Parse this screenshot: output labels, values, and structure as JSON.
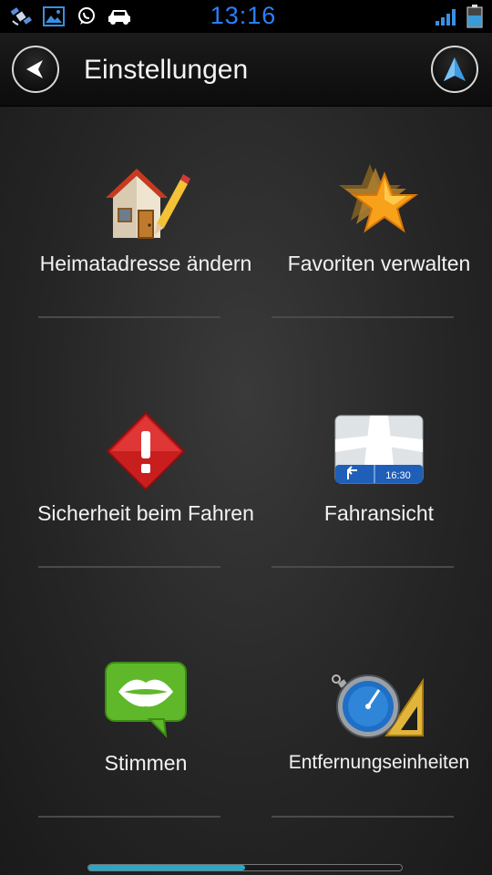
{
  "status_bar": {
    "time": "13:16",
    "icons": [
      "satellite-icon",
      "gallery-icon",
      "whatsapp-icon",
      "car-icon"
    ],
    "signal_icon": "signal-bars-icon",
    "battery_icon": "battery-icon"
  },
  "header": {
    "back_icon": "back-arrow-icon",
    "title": "Einstellungen",
    "nav_icon": "navigation-arrow-icon"
  },
  "menu": {
    "items": [
      {
        "label": "Heimatadresse ändern",
        "icon": "home-pencil-icon"
      },
      {
        "label": "Favoriten verwalten",
        "icon": "favorites-stars-icon"
      },
      {
        "label": "Sicherheit beim Fahren",
        "icon": "warning-diamond-icon"
      },
      {
        "label": "Fahransicht",
        "icon": "map-view-icon",
        "icon_text": "16:30"
      },
      {
        "label": "Stimmen",
        "icon": "voice-lips-icon"
      },
      {
        "label": "Entfernungseinheiten",
        "icon": "stopwatch-ruler-icon"
      }
    ]
  },
  "scroll": {
    "position_fraction": 0.5
  },
  "colors": {
    "clock": "#2a7fff",
    "accent": "#27a8c9",
    "background": "#262626"
  }
}
